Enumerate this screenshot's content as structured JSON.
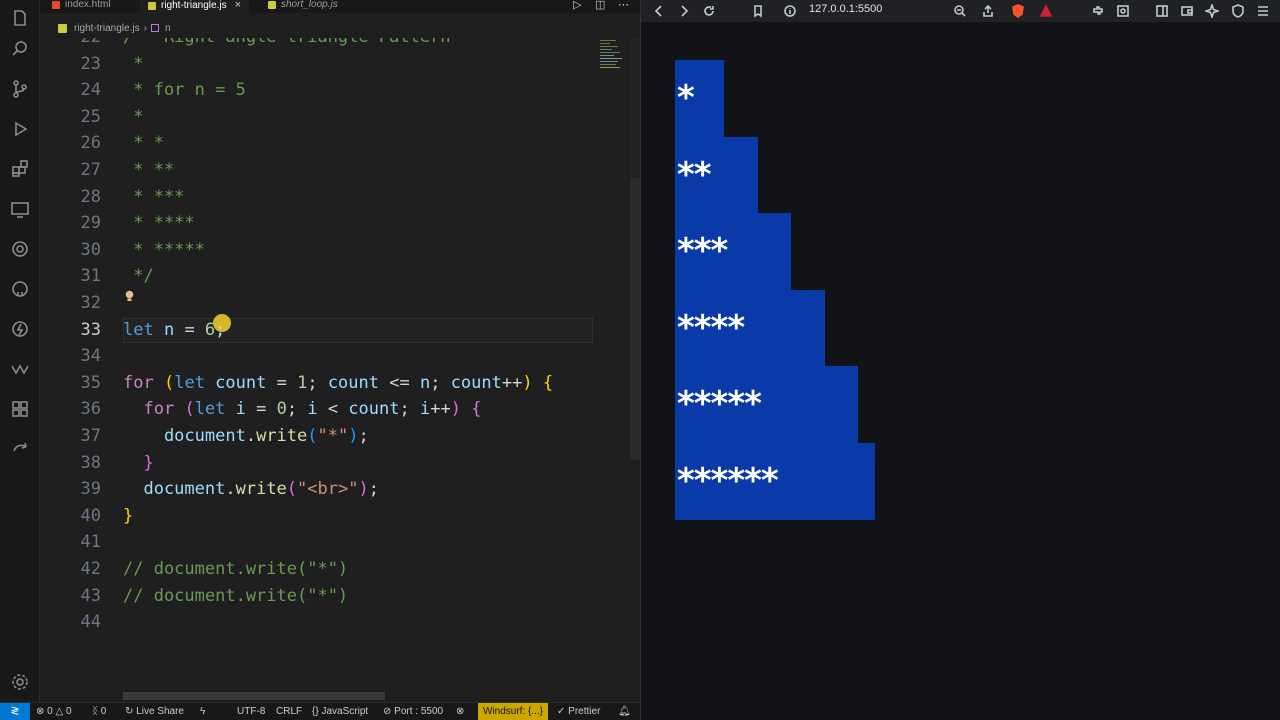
{
  "editor": {
    "tabs": [
      {
        "label": "index.html",
        "active": false
      },
      {
        "label": "right-triangle.js",
        "active": true
      },
      {
        "label": "short_loop.js",
        "active": false
      }
    ],
    "breadcrumb": {
      "file": "right-triangle.js",
      "symbol": "n"
    },
    "lines": [
      {
        "num": "22",
        "tokens": [
          {
            "t": "/*  Right angle triangle Pattern",
            "c": "cm"
          }
        ]
      },
      {
        "num": "23",
        "tokens": [
          {
            "t": " *",
            "c": "cm"
          }
        ]
      },
      {
        "num": "24",
        "tokens": [
          {
            "t": " * for n = 5",
            "c": "cm"
          }
        ]
      },
      {
        "num": "25",
        "tokens": [
          {
            "t": " *",
            "c": "cm"
          }
        ]
      },
      {
        "num": "26",
        "tokens": [
          {
            "t": " * *",
            "c": "cm"
          }
        ]
      },
      {
        "num": "27",
        "tokens": [
          {
            "t": " * **",
            "c": "cm"
          }
        ]
      },
      {
        "num": "28",
        "tokens": [
          {
            "t": " * ***",
            "c": "cm"
          }
        ]
      },
      {
        "num": "29",
        "tokens": [
          {
            "t": " * ****",
            "c": "cm"
          }
        ]
      },
      {
        "num": "30",
        "tokens": [
          {
            "t": " * *****",
            "c": "cm"
          }
        ]
      },
      {
        "num": "31",
        "tokens": [
          {
            "t": " */",
            "c": "cm"
          }
        ]
      },
      {
        "num": "32",
        "tokens": []
      },
      {
        "num": "33",
        "tokens": [
          {
            "t": "let",
            "c": "kw"
          },
          {
            "t": " n ",
            "c": "var"
          },
          {
            "t": "= ",
            "c": "op"
          },
          {
            "t": "6",
            "c": "num"
          },
          {
            "t": ";",
            "c": "op"
          }
        ]
      },
      {
        "num": "34",
        "tokens": []
      },
      {
        "num": "35",
        "tokens": [
          {
            "t": "for",
            "c": "ctl"
          },
          {
            "t": " ",
            "c": "op"
          },
          {
            "t": "(",
            "c": "p1"
          },
          {
            "t": "let",
            "c": "kw"
          },
          {
            "t": " count ",
            "c": "var"
          },
          {
            "t": "= ",
            "c": "op"
          },
          {
            "t": "1",
            "c": "num"
          },
          {
            "t": "; ",
            "c": "op"
          },
          {
            "t": "count ",
            "c": "var"
          },
          {
            "t": "<= ",
            "c": "op"
          },
          {
            "t": "n",
            "c": "var"
          },
          {
            "t": "; ",
            "c": "op"
          },
          {
            "t": "count",
            "c": "var"
          },
          {
            "t": "++",
            "c": "op"
          },
          {
            "t": ")",
            "c": "p1"
          },
          {
            "t": " ",
            "c": "op"
          },
          {
            "t": "{",
            "c": "p1"
          }
        ]
      },
      {
        "num": "36",
        "tokens": [
          {
            "t": "  for",
            "c": "ctl"
          },
          {
            "t": " ",
            "c": "op"
          },
          {
            "t": "(",
            "c": "p2"
          },
          {
            "t": "let",
            "c": "kw"
          },
          {
            "t": " i ",
            "c": "var"
          },
          {
            "t": "= ",
            "c": "op"
          },
          {
            "t": "0",
            "c": "num"
          },
          {
            "t": "; ",
            "c": "op"
          },
          {
            "t": "i ",
            "c": "var"
          },
          {
            "t": "< ",
            "c": "op"
          },
          {
            "t": "count",
            "c": "var"
          },
          {
            "t": "; ",
            "c": "op"
          },
          {
            "t": "i",
            "c": "var"
          },
          {
            "t": "++",
            "c": "op"
          },
          {
            "t": ")",
            "c": "p2"
          },
          {
            "t": " ",
            "c": "op"
          },
          {
            "t": "{",
            "c": "p2"
          }
        ]
      },
      {
        "num": "37",
        "tokens": [
          {
            "t": "    document",
            "c": "var"
          },
          {
            "t": ".",
            "c": "op"
          },
          {
            "t": "write",
            "c": "fn"
          },
          {
            "t": "(",
            "c": "p3"
          },
          {
            "t": "\"*\"",
            "c": "str"
          },
          {
            "t": ")",
            "c": "p3"
          },
          {
            "t": ";",
            "c": "op"
          }
        ]
      },
      {
        "num": "38",
        "tokens": [
          {
            "t": "  }",
            "c": "p2"
          }
        ]
      },
      {
        "num": "39",
        "tokens": [
          {
            "t": "  document",
            "c": "var"
          },
          {
            "t": ".",
            "c": "op"
          },
          {
            "t": "write",
            "c": "fn"
          },
          {
            "t": "(",
            "c": "p2"
          },
          {
            "t": "\"<br>\"",
            "c": "str"
          },
          {
            "t": ")",
            "c": "p2"
          },
          {
            "t": ";",
            "c": "op"
          }
        ]
      },
      {
        "num": "40",
        "tokens": [
          {
            "t": "}",
            "c": "p1"
          }
        ]
      },
      {
        "num": "41",
        "tokens": []
      },
      {
        "num": "42",
        "tokens": [
          {
            "t": "// document.write(\"*\")",
            "c": "cm"
          }
        ]
      },
      {
        "num": "43",
        "tokens": [
          {
            "t": "// document.write(\"*\")",
            "c": "cm"
          }
        ]
      },
      {
        "num": "44",
        "tokens": []
      }
    ],
    "current_line": "33"
  },
  "statusbar": {
    "remote": "≷",
    "errors": "0",
    "warnings": "0",
    "ports": "0",
    "live_share": "Live Share",
    "encoding": "UTF-8",
    "eol": "CRLF",
    "language": "JavaScript",
    "port": "Port : 5500",
    "windsurf": "Windsurf: {...}",
    "prettier": "Prettier"
  },
  "browser": {
    "url": "127.0.0.1:5500",
    "pattern_rows": [
      "*",
      "**",
      "***",
      "****",
      "*****",
      "******"
    ]
  },
  "colors": {
    "highlight_bg": "#0a3aa8",
    "accent": "#0078d4",
    "windsurf": "#cca700"
  }
}
